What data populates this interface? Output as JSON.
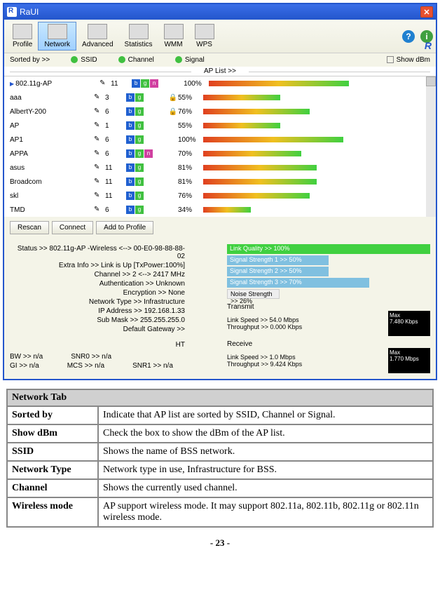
{
  "window": {
    "title": "RaUI"
  },
  "toolbar": {
    "items": [
      "Profile",
      "Network",
      "Advanced",
      "Statistics",
      "WMM",
      "WPS"
    ],
    "r": "R"
  },
  "sortbar": {
    "label": "Sorted by >>",
    "ssid": "SSID",
    "channel": "Channel",
    "signal": "Signal",
    "showdbm": "Show dBm"
  },
  "aplist": {
    "header": "AP List >>",
    "rows": [
      {
        "name": "802.11g-AP",
        "ch": "11",
        "modes": [
          "b",
          "g",
          "n"
        ],
        "lock": false,
        "pct": "100%",
        "bar": 100
      },
      {
        "name": "aaa",
        "ch": "3",
        "modes": [
          "b",
          "g"
        ],
        "lock": true,
        "pct": "55%",
        "bar": 55
      },
      {
        "name": "AlbertY-200",
        "ch": "6",
        "modes": [
          "b",
          "g"
        ],
        "lock": true,
        "pct": "76%",
        "bar": 76
      },
      {
        "name": "AP",
        "ch": "1",
        "modes": [
          "b",
          "g"
        ],
        "lock": false,
        "pct": "55%",
        "bar": 55
      },
      {
        "name": "AP1",
        "ch": "6",
        "modes": [
          "b",
          "g"
        ],
        "lock": false,
        "pct": "100%",
        "bar": 100
      },
      {
        "name": "APPA",
        "ch": "6",
        "modes": [
          "b",
          "g",
          "n"
        ],
        "lock": false,
        "pct": "70%",
        "bar": 70
      },
      {
        "name": "asus",
        "ch": "11",
        "modes": [
          "b",
          "g"
        ],
        "lock": false,
        "pct": "81%",
        "bar": 81
      },
      {
        "name": "Broadcom",
        "ch": "11",
        "modes": [
          "b",
          "g"
        ],
        "lock": false,
        "pct": "81%",
        "bar": 81
      },
      {
        "name": "skl",
        "ch": "11",
        "modes": [
          "b",
          "g"
        ],
        "lock": false,
        "pct": "76%",
        "bar": 76
      },
      {
        "name": "TMD",
        "ch": "6",
        "modes": [
          "b",
          "g"
        ],
        "lock": false,
        "pct": "34%",
        "bar": 34
      }
    ]
  },
  "buttons": {
    "rescan": "Rescan",
    "connect": "Connect",
    "addprofile": "Add to Profile"
  },
  "status": {
    "s1": "Status >> 802.11g-AP -Wireless  <--> 00-E0-98-88-88-02",
    "s2": "Extra Info >> Link is Up [TxPower:100%]",
    "s3": "Channel >> 2 <--> 2417 MHz",
    "s4": "Authentication >> Unknown",
    "s5": "Encryption >> None",
    "s6": "Network Type >> Infrastructure",
    "s7": "IP Address >> 192.168.1.33",
    "s8": "Sub Mask >> 255.255.255.0",
    "s9": "Default Gateway >>"
  },
  "quality": {
    "q1": "Link Quality >> 100%",
    "q2": "Signal Strength 1 >> 50%",
    "q3": "Signal Strength 2 >> 50%",
    "q4": "Signal Strength 3 >> 70%",
    "q5": "Noise Strength >> 26%"
  },
  "transmit": {
    "label": "Transmit",
    "l1": "Link Speed >> 54.0 Mbps",
    "l2": "Throughput >> 0.000 Kbps",
    "box1": "Max",
    "box2": "7.480 Kbps"
  },
  "receive": {
    "label": "Receive",
    "l1": "Link Speed >> 1.0 Mbps",
    "l2": "Throughput >> 9.424 Kbps",
    "box1": "Max",
    "box2": "1.770 Mbps"
  },
  "ht": {
    "title": "HT",
    "bw": "BW >> n/a",
    "gi": "GI >> n/a",
    "mcs": "MCS >> n/a",
    "snr0": "SNR0 >> n/a",
    "snr1": "SNR1 >> n/a"
  },
  "table": {
    "header": "Network Tab",
    "rows": [
      {
        "k": "Sorted by",
        "v": "Indicate that AP list are sorted by SSID, Channel or Signal."
      },
      {
        "k": "Show dBm",
        "v": "Check the box to show the dBm of the AP list."
      },
      {
        "k": "SSID",
        "v": "Shows the name of BSS network."
      },
      {
        "k": "Network Type",
        "v": "Network type in use, Infrastructure for BSS."
      },
      {
        "k": "Channel",
        "v": "Shows the currently used channel."
      },
      {
        "k": "Wireless mode",
        "v": "AP support wireless mode. It may support 802.11a, 802.11b, 802.11g or 802.11n wireless mode."
      }
    ]
  },
  "pagenum": "- 23 -"
}
